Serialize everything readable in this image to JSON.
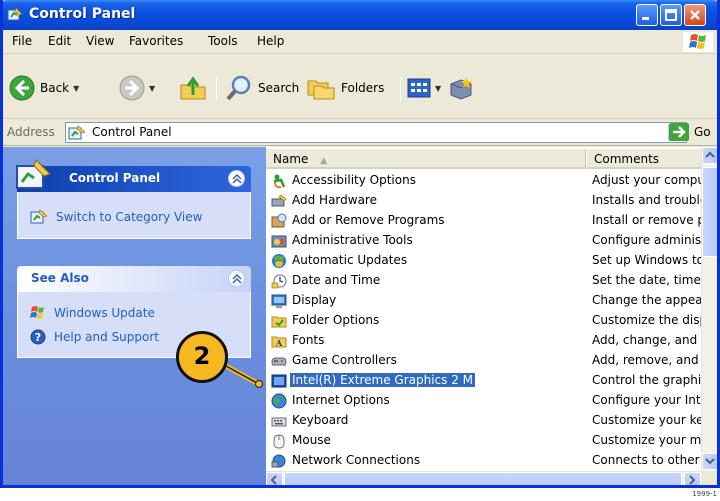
{
  "window": {
    "title": "Control Panel",
    "controls": [
      "minimize-icon",
      "maximize-icon",
      "close-icon"
    ]
  },
  "menu": [
    "File",
    "Edit",
    "View",
    "Favorites",
    "Tools",
    "Help"
  ],
  "toolbar": {
    "back": "Back",
    "search": "Search",
    "folders": "Folders"
  },
  "address": {
    "label": "Address",
    "value": "Control Panel",
    "go": "Go"
  },
  "taskpane": {
    "control_panel": {
      "title": "Control Panel",
      "switch_link": "Switch to Category View"
    },
    "see_also": {
      "title": "See Also",
      "links": [
        "Windows Update",
        "Help and Support"
      ]
    }
  },
  "list": {
    "columns": {
      "name": "Name",
      "comments": "Comments"
    },
    "rows": [
      {
        "name": "Accessibility Options",
        "comment": "Adjust your comput",
        "icon": "accessibility-icon"
      },
      {
        "name": "Add Hardware",
        "comment": "Installs and trouble",
        "icon": "hardware-icon"
      },
      {
        "name": "Add or Remove Programs",
        "comment": "Install or remove pr",
        "icon": "programs-icon"
      },
      {
        "name": "Administrative Tools",
        "comment": "Configure administr",
        "icon": "admin-tools-icon"
      },
      {
        "name": "Automatic Updates",
        "comment": "Set up Windows to",
        "icon": "updates-icon"
      },
      {
        "name": "Date and Time",
        "comment": "Set the date, time,",
        "icon": "clock-icon"
      },
      {
        "name": "Display",
        "comment": "Change the appear",
        "icon": "display-icon"
      },
      {
        "name": "Folder Options",
        "comment": "Customize the displ",
        "icon": "folder-options-icon"
      },
      {
        "name": "Fonts",
        "comment": "Add, change, and .",
        "icon": "fonts-icon"
      },
      {
        "name": "Game Controllers",
        "comment": "Add, remove, and c",
        "icon": "game-controller-icon"
      },
      {
        "name": "Intel(R) Extreme Graphics 2 M",
        "comment": "Control the graphic",
        "icon": "intel-graphics-icon",
        "selected": true
      },
      {
        "name": "Internet Options",
        "comment": "Configure your Inte",
        "icon": "globe-icon"
      },
      {
        "name": "Keyboard",
        "comment": "Customize your key",
        "icon": "keyboard-icon"
      },
      {
        "name": "Mouse",
        "comment": "Customize your mo",
        "icon": "mouse-icon"
      },
      {
        "name": "Network Connections",
        "comment": "Connects to other c",
        "icon": "network-icon"
      }
    ]
  },
  "callout": {
    "number": "2"
  },
  "figure_id": "1999-1"
}
